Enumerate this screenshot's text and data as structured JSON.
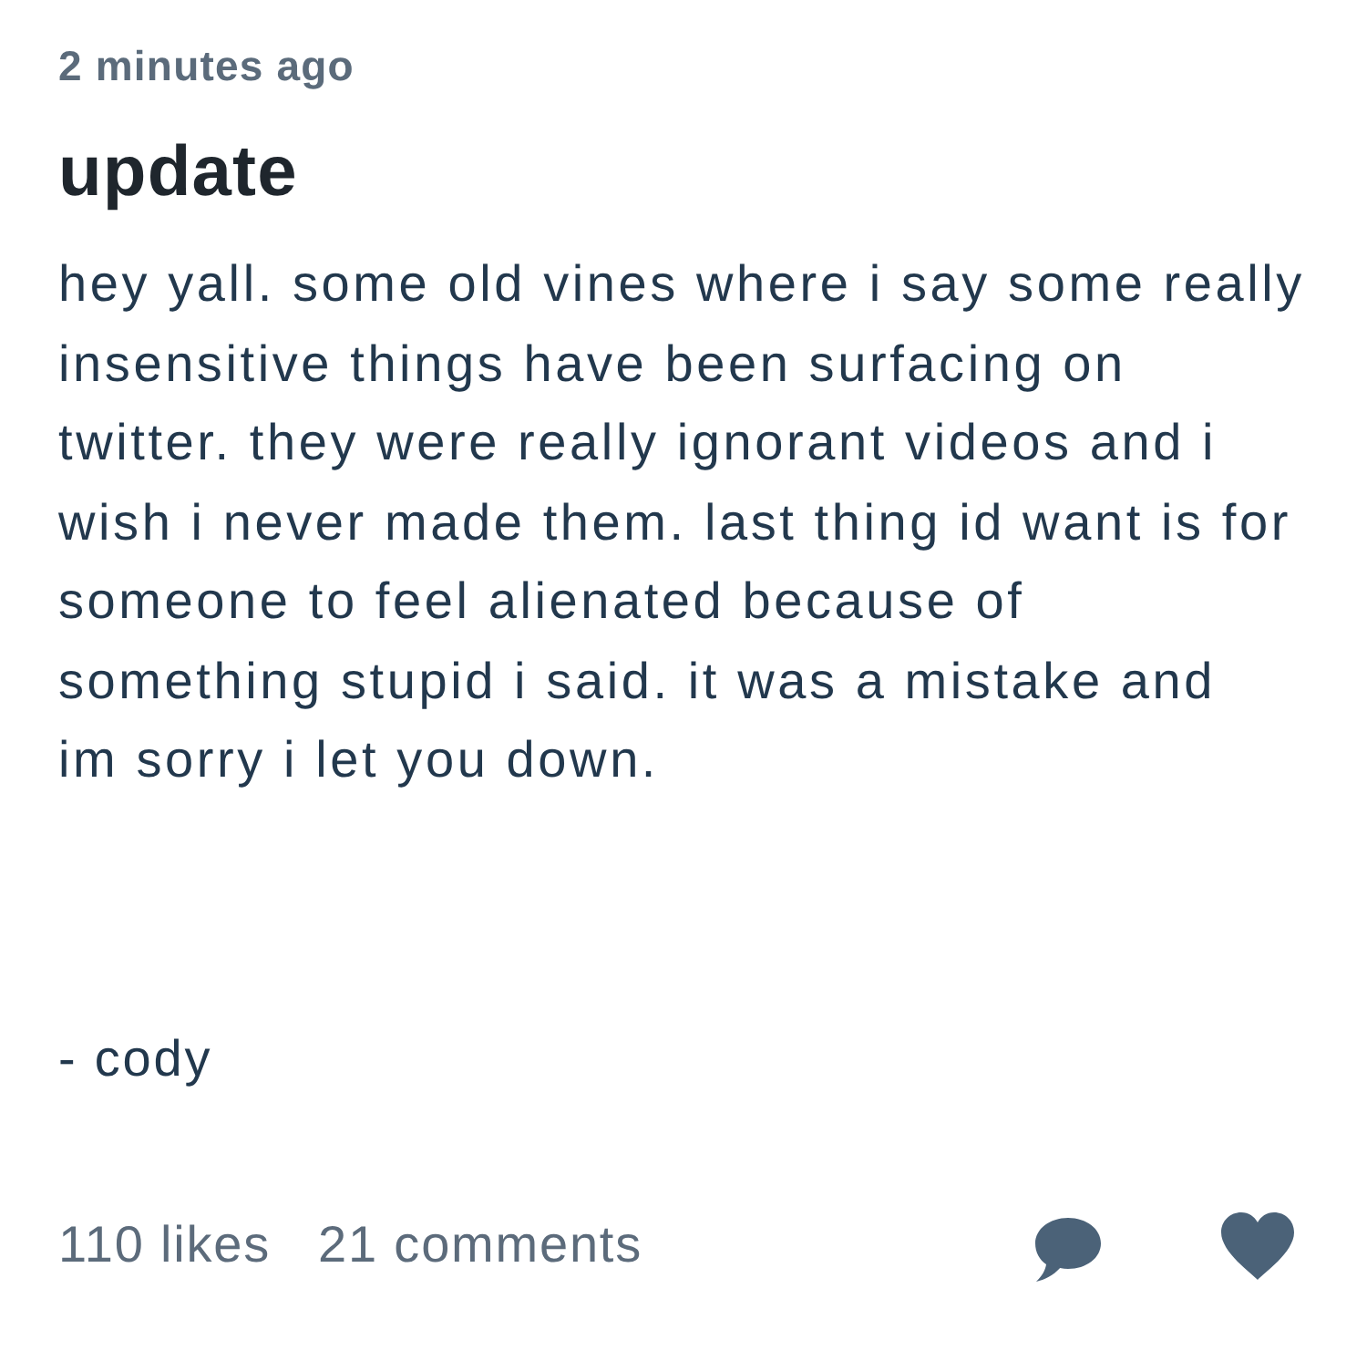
{
  "post": {
    "timestamp": "2 minutes ago",
    "title": "update",
    "body": "hey yall. some old vines where i say some really insensitive things have been surfacing on twitter. they were really ignorant videos and i wish i never made them. last thing id want is for someone to feel alienated because of something stupid i said. it was a mistake and im sorry i let you down.",
    "signature": "- cody"
  },
  "footer": {
    "likes": "110 likes",
    "comments": "21 comments"
  }
}
